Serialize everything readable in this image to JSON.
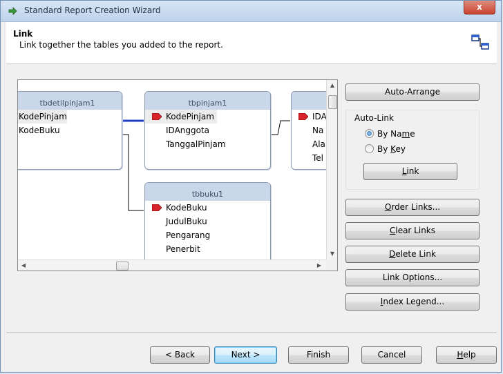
{
  "window": {
    "title": "Standard Report Creation Wizard",
    "close_glyph": "x"
  },
  "header": {
    "title": "Link",
    "subtitle": "Link together the tables you added to the report."
  },
  "diagram": {
    "tables": [
      {
        "name": "tbdetilpinjam1",
        "fields": [
          "KodePinjam",
          "KodeBuku"
        ]
      },
      {
        "name": "tbpinjam1",
        "fields": [
          "KodePinjam",
          "IDAnggota",
          "TanggalPinjam"
        ]
      },
      {
        "name": "",
        "fields": [
          "IDA",
          "Na",
          "Ala",
          "Tel"
        ]
      },
      {
        "name": "tbbuku1",
        "fields": [
          "KodeBuku",
          "JudulBuku",
          "Pengarang",
          "Penerbit"
        ]
      }
    ]
  },
  "actions": {
    "auto_arrange": "Auto-Arrange",
    "auto_link_label": "Auto-Link",
    "by_name": {
      "pre": "By Na",
      "key": "m",
      "post": "e"
    },
    "by_key": {
      "pre": "By ",
      "key": "K",
      "post": "ey"
    },
    "link": {
      "pre": "",
      "key": "L",
      "post": "ink"
    },
    "order_links": {
      "pre": "",
      "key": "O",
      "post": "rder Links..."
    },
    "clear_links": {
      "pre": "",
      "key": "C",
      "post": "lear Links"
    },
    "delete_link": {
      "pre": "",
      "key": "D",
      "post": "elete Link"
    },
    "link_options": "Link Options...",
    "index_legend": {
      "pre": "",
      "key": "I",
      "post": "ndex Legend..."
    }
  },
  "footer": {
    "back": "< Back",
    "next": "Next >",
    "finish": "Finish",
    "cancel": "Cancel",
    "help": {
      "pre": "",
      "key": "H",
      "post": "elp"
    }
  },
  "colors": {
    "link_line": "#1f3fd0",
    "key_marker": "#d9232a",
    "table_header": "#c9d7e8"
  }
}
